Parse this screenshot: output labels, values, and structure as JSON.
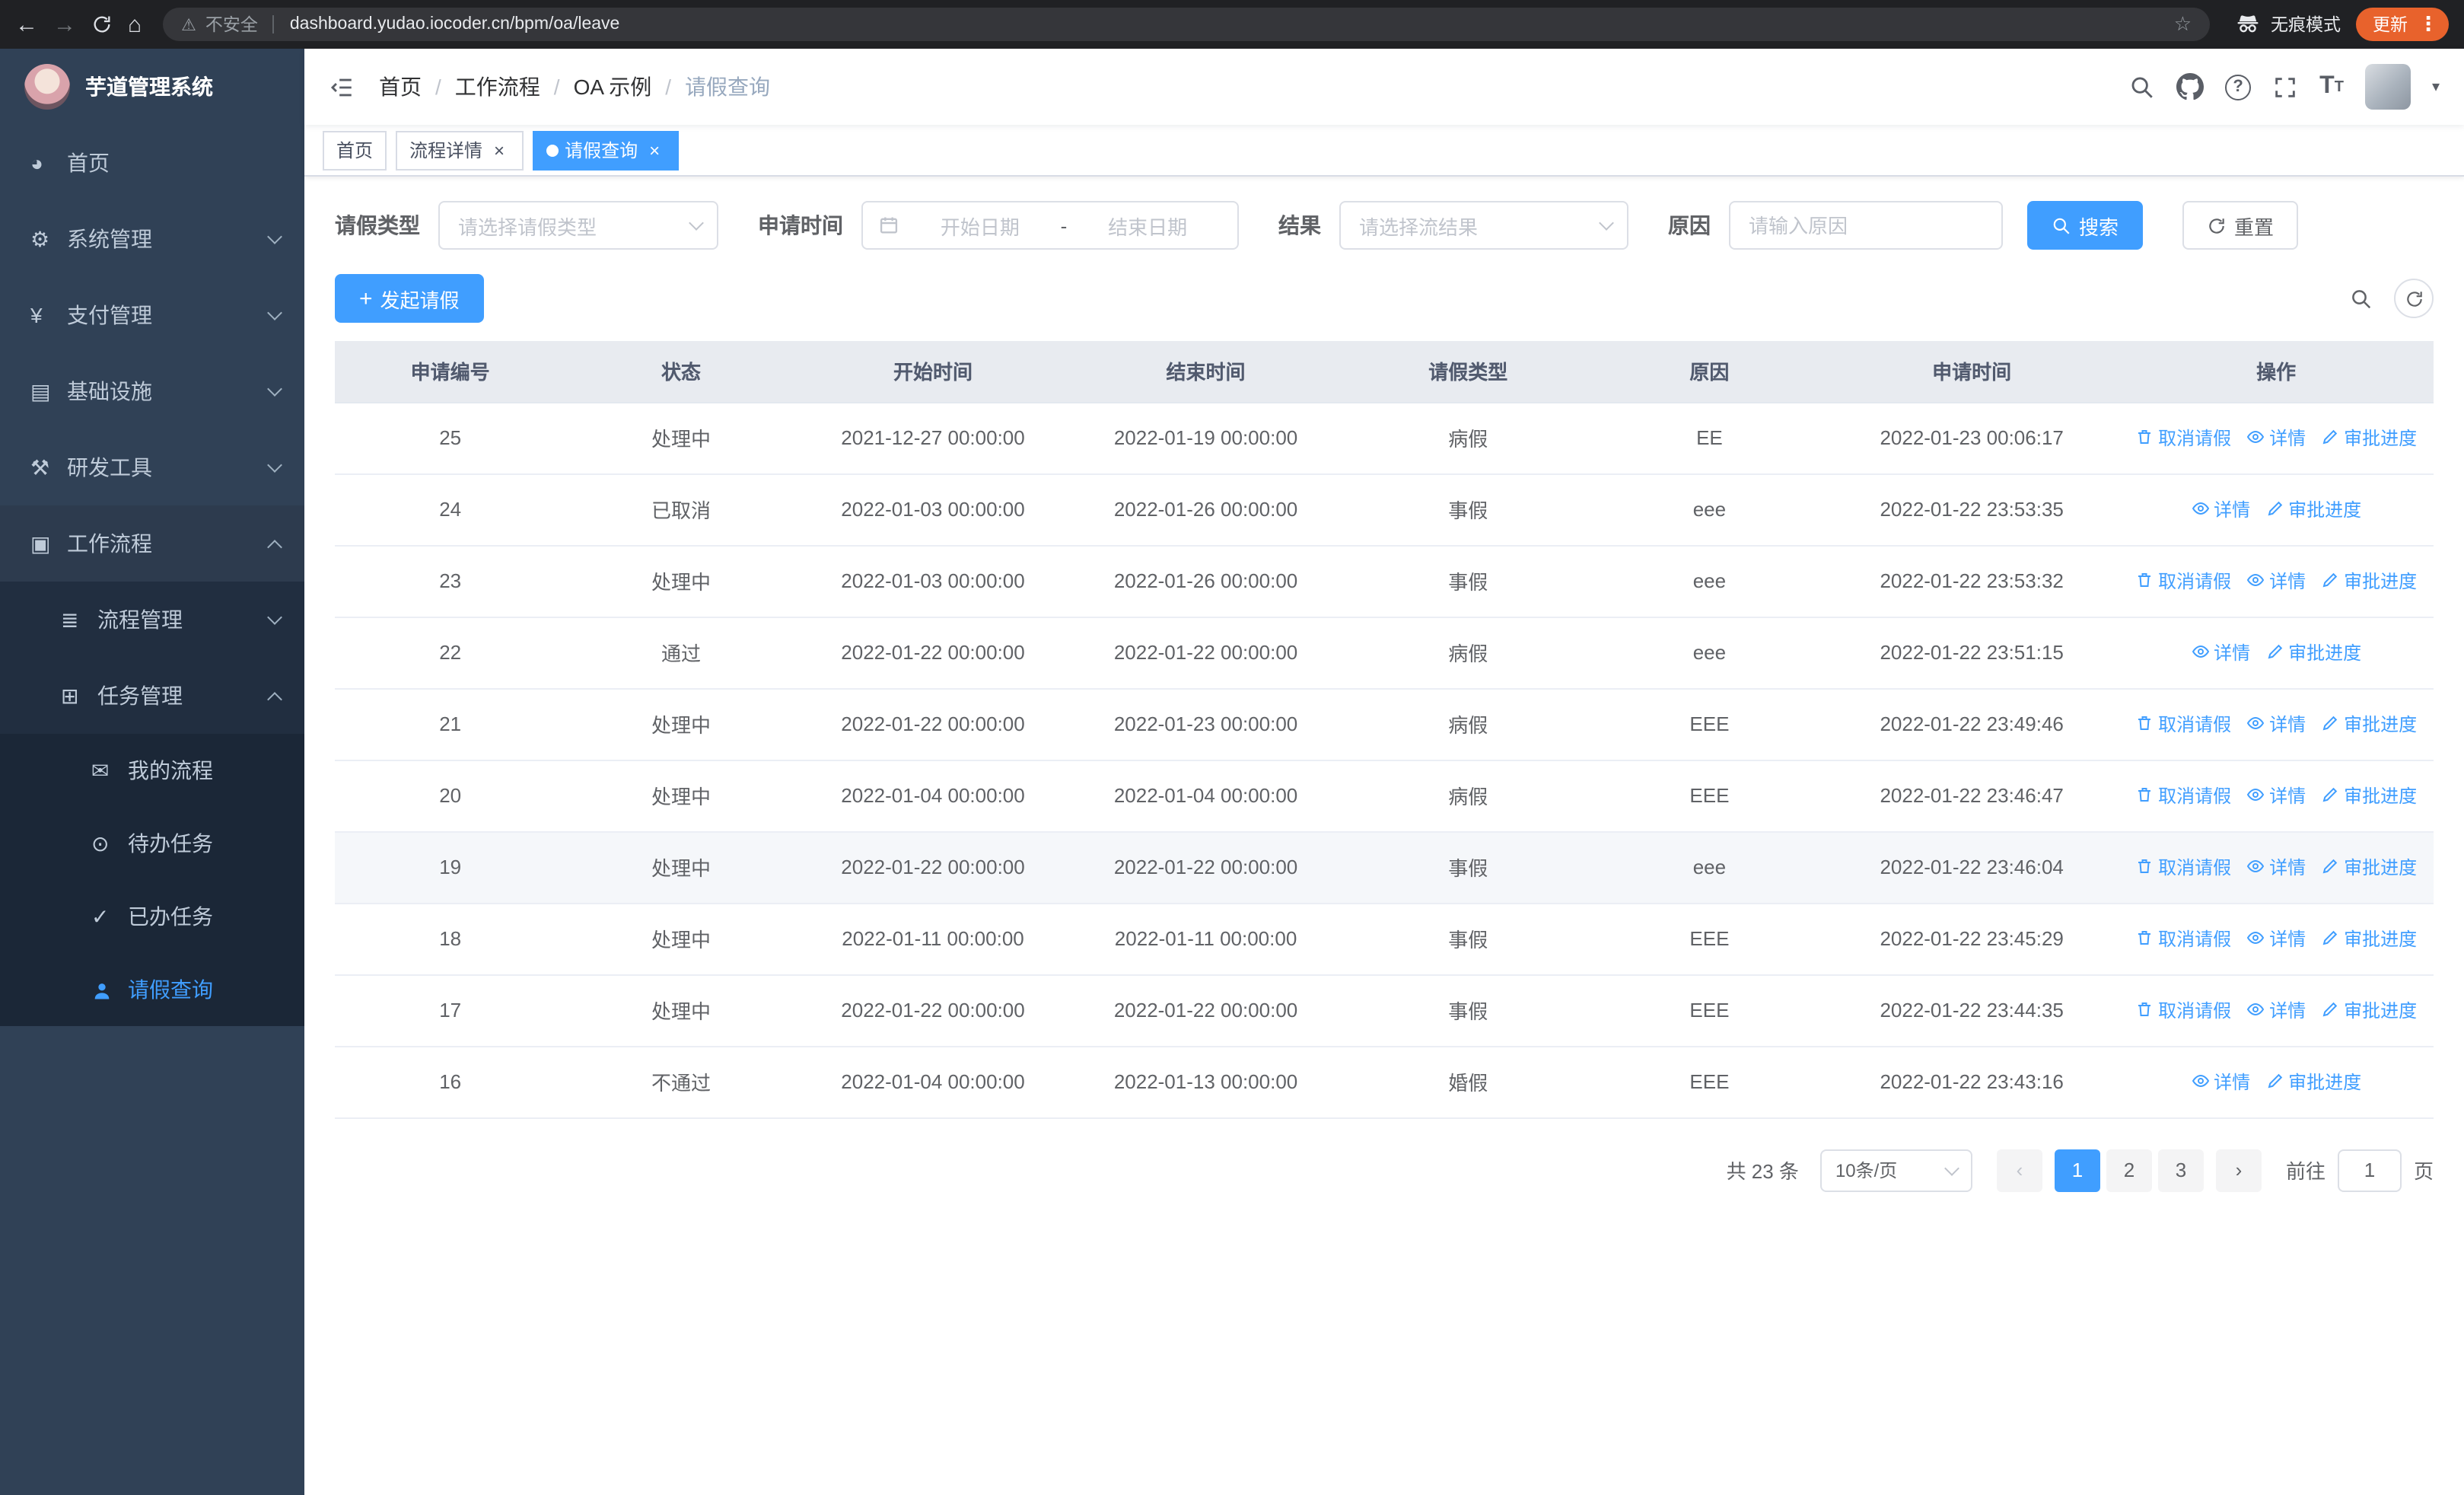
{
  "browser": {
    "insecure_label": "不安全",
    "url": "dashboard.yudao.iocoder.cn/bpm/oa/leave",
    "incognito_label": "无痕模式",
    "update_label": "更新"
  },
  "sidebar": {
    "title": "芋道管理系统",
    "items": [
      {
        "id": "home",
        "label": "首页",
        "icon": "dashboard-icon",
        "level": 1
      },
      {
        "id": "system",
        "label": "系统管理",
        "icon": "gear-icon",
        "level": 1,
        "arrow": "down"
      },
      {
        "id": "payment",
        "label": "支付管理",
        "icon": "yen-icon",
        "level": 1,
        "arrow": "down"
      },
      {
        "id": "infra",
        "label": "基础设施",
        "icon": "server-icon",
        "level": 1,
        "arrow": "down"
      },
      {
        "id": "devtools",
        "label": "研发工具",
        "icon": "tools-icon",
        "level": 1,
        "arrow": "down"
      },
      {
        "id": "workflow",
        "label": "工作流程",
        "icon": "briefcase-icon",
        "level": 1,
        "arrow": "up",
        "open": true
      },
      {
        "id": "process-mgmt",
        "label": "流程管理",
        "icon": "list-icon",
        "level": 2,
        "arrow": "down"
      },
      {
        "id": "task-mgmt",
        "label": "任务管理",
        "icon": "tag-icon",
        "level": 2,
        "arrow": "up",
        "open": true
      },
      {
        "id": "my-process",
        "label": "我的流程",
        "icon": "chat-icon",
        "level": 3
      },
      {
        "id": "todo-tasks",
        "label": "待办任务",
        "icon": "eye-icon",
        "level": 3
      },
      {
        "id": "done-tasks",
        "label": "已办任务",
        "icon": "check-icon",
        "level": 3
      },
      {
        "id": "leave-query",
        "label": "请假查询",
        "icon": "user-icon",
        "level": 3,
        "active": true
      }
    ]
  },
  "header": {
    "breadcrumb": [
      "首页",
      "工作流程",
      "OA 示例",
      "请假查询"
    ]
  },
  "tabs": [
    {
      "id": "home",
      "label": "首页"
    },
    {
      "id": "process-detail",
      "label": "流程详情",
      "closable": true
    },
    {
      "id": "leave-query",
      "label": "请假查询",
      "closable": true,
      "active": true
    }
  ],
  "filters": {
    "leave_type_label": "请假类型",
    "leave_type_placeholder": "请选择请假类型",
    "apply_time_label": "申请时间",
    "start_date_placeholder": "开始日期",
    "range_separator": "-",
    "end_date_placeholder": "结束日期",
    "result_label": "结果",
    "result_placeholder": "请选择流结果",
    "reason_label": "原因",
    "reason_placeholder": "请输入原因",
    "search_label": "搜索",
    "reset_label": "重置"
  },
  "toolbar": {
    "create_label": "发起请假"
  },
  "table": {
    "columns": [
      "申请编号",
      "状态",
      "开始时间",
      "结束时间",
      "请假类型",
      "原因",
      "申请时间",
      "操作"
    ],
    "action_labels": {
      "cancel": "取消请假",
      "detail": "详情",
      "progress": "审批进度"
    },
    "rows": [
      {
        "id": "25",
        "status": "处理中",
        "start_time": "2021-12-27 00:00:00",
        "end_time": "2022-01-19 00:00:00",
        "leave_type": "病假",
        "reason": "EE",
        "apply_time": "2022-01-23 00:06:17",
        "actions": [
          "cancel",
          "detail",
          "progress"
        ]
      },
      {
        "id": "24",
        "status": "已取消",
        "start_time": "2022-01-03 00:00:00",
        "end_time": "2022-01-26 00:00:00",
        "leave_type": "事假",
        "reason": "eee",
        "apply_time": "2022-01-22 23:53:35",
        "actions": [
          "detail",
          "progress"
        ]
      },
      {
        "id": "23",
        "status": "处理中",
        "start_time": "2022-01-03 00:00:00",
        "end_time": "2022-01-26 00:00:00",
        "leave_type": "事假",
        "reason": "eee",
        "apply_time": "2022-01-22 23:53:32",
        "actions": [
          "cancel",
          "detail",
          "progress"
        ]
      },
      {
        "id": "22",
        "status": "通过",
        "start_time": "2022-01-22 00:00:00",
        "end_time": "2022-01-22 00:00:00",
        "leave_type": "病假",
        "reason": "eee",
        "apply_time": "2022-01-22 23:51:15",
        "actions": [
          "detail",
          "progress"
        ]
      },
      {
        "id": "21",
        "status": "处理中",
        "start_time": "2022-01-22 00:00:00",
        "end_time": "2022-01-23 00:00:00",
        "leave_type": "病假",
        "reason": "EEE",
        "apply_time": "2022-01-22 23:49:46",
        "actions": [
          "cancel",
          "detail",
          "progress"
        ]
      },
      {
        "id": "20",
        "status": "处理中",
        "start_time": "2022-01-04 00:00:00",
        "end_time": "2022-01-04 00:00:00",
        "leave_type": "病假",
        "reason": "EEE",
        "apply_time": "2022-01-22 23:46:47",
        "actions": [
          "cancel",
          "detail",
          "progress"
        ]
      },
      {
        "id": "19",
        "status": "处理中",
        "start_time": "2022-01-22 00:00:00",
        "end_time": "2022-01-22 00:00:00",
        "leave_type": "事假",
        "reason": "eee",
        "apply_time": "2022-01-22 23:46:04",
        "actions": [
          "cancel",
          "detail",
          "progress"
        ],
        "hover": true
      },
      {
        "id": "18",
        "status": "处理中",
        "start_time": "2022-01-11 00:00:00",
        "end_time": "2022-01-11 00:00:00",
        "leave_type": "事假",
        "reason": "EEE",
        "apply_time": "2022-01-22 23:45:29",
        "actions": [
          "cancel",
          "detail",
          "progress"
        ]
      },
      {
        "id": "17",
        "status": "处理中",
        "start_time": "2022-01-22 00:00:00",
        "end_time": "2022-01-22 00:00:00",
        "leave_type": "事假",
        "reason": "EEE",
        "apply_time": "2022-01-22 23:44:35",
        "actions": [
          "cancel",
          "detail",
          "progress"
        ]
      },
      {
        "id": "16",
        "status": "不通过",
        "start_time": "2022-01-04 00:00:00",
        "end_time": "2022-01-13 00:00:00",
        "leave_type": "婚假",
        "reason": "EEE",
        "apply_time": "2022-01-22 23:43:16",
        "actions": [
          "detail",
          "progress"
        ]
      }
    ]
  },
  "pagination": {
    "total_label": "共 23 条",
    "page_size_label": "10条/页",
    "pages": [
      "1",
      "2",
      "3"
    ],
    "current": "1",
    "goto_label": "前往",
    "goto_value": "1",
    "page_unit_label": "页"
  },
  "colors": {
    "primary": "#409eff",
    "chrome_bg": "#202124",
    "update_button": "#e8622c",
    "sidebar_bg": "#304156",
    "sidebar_open_bg": "#2d3b4e",
    "sidebar_sub_bg": "#212e40",
    "sidebar_deep_bg": "#1b2737",
    "sidebar_text": "#bfcbd9",
    "table_header_bg": "#e8ebf0",
    "hover_row_bg": "#f5f7fa"
  }
}
